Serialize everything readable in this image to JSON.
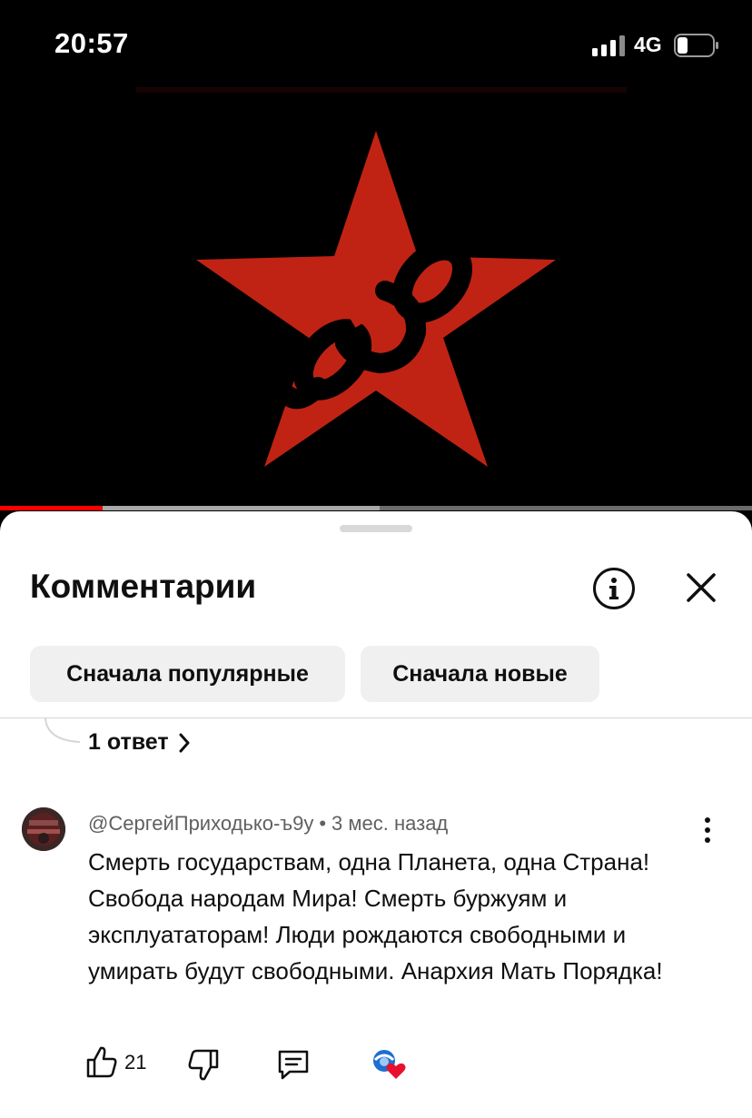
{
  "status_bar": {
    "time": "20:57",
    "network": "4G",
    "icons": [
      "signal-icon",
      "battery-icon"
    ]
  },
  "video": {
    "progress": 0.137,
    "buffered": 0.505,
    "accent_color": "#ff0000",
    "star_color": "#c02314"
  },
  "comments_panel": {
    "title": "Комментарии",
    "icons": [
      "info-icon",
      "close-icon"
    ],
    "sort_chips": [
      {
        "label": "Сначала популярные"
      },
      {
        "label": "Сначала новые"
      }
    ],
    "replies_link": "1 ответ"
  },
  "comment": {
    "author": "@СергейПриходько-ъ9у",
    "separator": "•",
    "time": "3 мес. назад",
    "text": "Смерть государствам, одна Планета, одна Страна! Свобода народам Мира! Смерть буржуям и эксплуататорам! Люди рождаются свободными и умирать будут свободными. Анархия Мать Порядка!",
    "likes": "21",
    "icons": [
      "thumbs-up-icon",
      "thumbs-down-icon",
      "reply-icon",
      "creator-heart-icon",
      "more-vert-icon"
    ]
  }
}
